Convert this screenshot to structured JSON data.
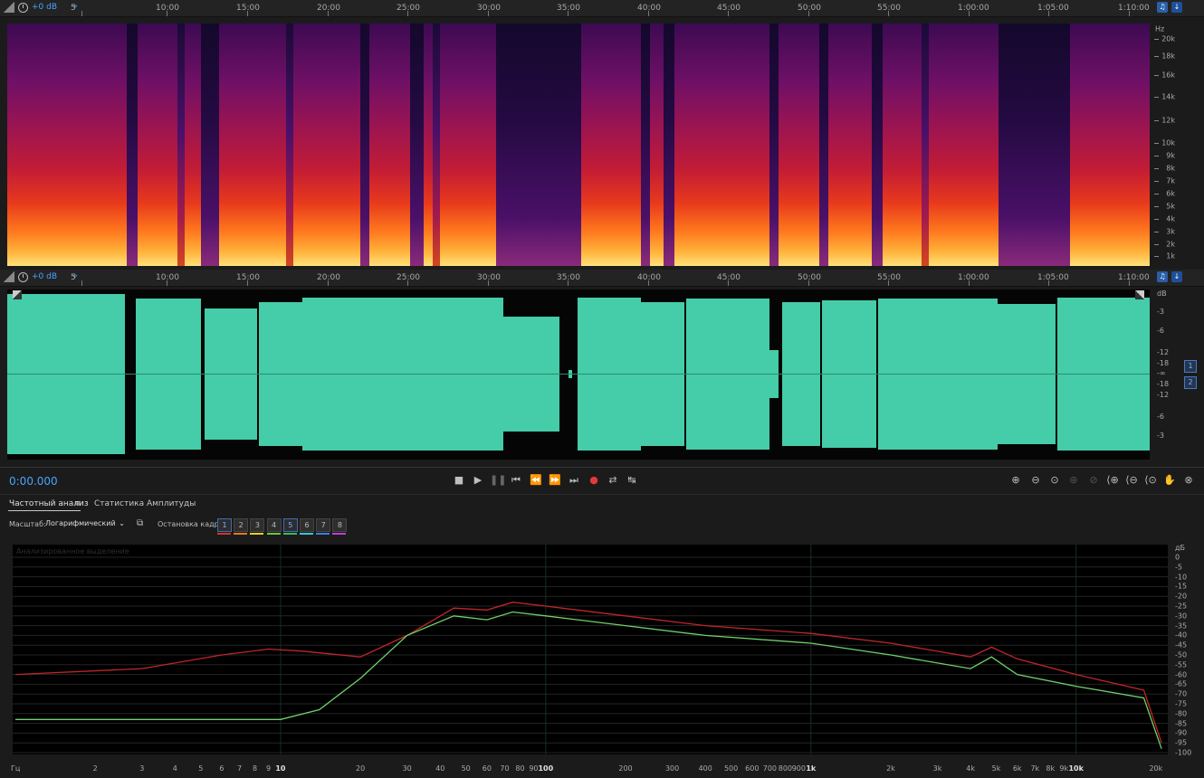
{
  "top_ruler": {
    "level": "+0 dB",
    "ticks": [
      "5",
      "10:00",
      "15:00",
      "20:00",
      "25:00",
      "30:00",
      "35:00",
      "40:00",
      "45:00",
      "50:00",
      "55:00",
      "1:00:00",
      "1:05:00",
      "1:10:00"
    ]
  },
  "spectrogram": {
    "y_unit": "Hz",
    "y_labels": [
      "20k",
      "18k",
      "16k",
      "14k",
      "12k",
      "10k",
      "9k",
      "8k",
      "7k",
      "6k",
      "5k",
      "4k",
      "3k",
      "2k",
      "1k"
    ]
  },
  "wave_ruler": {
    "level": "+0 dB",
    "ticks": [
      "5",
      "10:00",
      "15:00",
      "20:00",
      "25:00",
      "30:00",
      "35:00",
      "40:00",
      "45:00",
      "50:00",
      "55:00",
      "1:00:00",
      "1:05:00",
      "1:10:00"
    ]
  },
  "waveform": {
    "db_unit": "dB",
    "db_labels": [
      "-3",
      "-6",
      "-12",
      "-18",
      "-∞",
      "-18",
      "-12",
      "-6",
      "-3"
    ],
    "channels": [
      "1",
      "2"
    ],
    "channel_color": "#45cca8"
  },
  "transport": {
    "time": "0:00.000",
    "buttons": [
      "stop",
      "play",
      "pause",
      "go-start",
      "rewind",
      "forward",
      "go-end",
      "record",
      "loop",
      "skip"
    ]
  },
  "analysis": {
    "tab_freq": "Частотный анализ",
    "tab_menu": "≡",
    "tab_amp": "Статистика Амплитуды",
    "scale_label": "Масштаб:",
    "scale_value": "Логарифмический",
    "freeze_label": "Остановка кадра:",
    "frames": [
      "1",
      "2",
      "3",
      "4",
      "5",
      "6",
      "7",
      "8"
    ],
    "frame_colors": [
      "#d0352d",
      "#e07b22",
      "#e6d027",
      "#6cc83a",
      "#3fb85f",
      "#3ac6d6",
      "#3a7de0",
      "#c53ad6"
    ],
    "overlay_text": "Анализированное выделение",
    "x_unit": "Гц",
    "x_labels": [
      "2",
      "3",
      "4",
      "5",
      "6",
      "7",
      "8",
      "9",
      "10",
      "20",
      "30",
      "40",
      "50",
      "60",
      "70",
      "80",
      "90",
      "100",
      "200",
      "300",
      "400",
      "500",
      "600",
      "700",
      "800",
      "900",
      "1k",
      "2k",
      "3k",
      "4k",
      "5k",
      "6k",
      "7k",
      "8k",
      "9k",
      "10k",
      "20k"
    ],
    "y_unit": "дБ",
    "y_labels": [
      "0",
      "-5",
      "-10",
      "-15",
      "-20",
      "-25",
      "-30",
      "-35",
      "-40",
      "-45",
      "-50",
      "-55",
      "-60",
      "-65",
      "-70",
      "-75",
      "-80",
      "-85",
      "-90",
      "-95",
      "-100"
    ],
    "line_colors": {
      "red": "#c0262a",
      "green": "#6fd16a"
    }
  }
}
